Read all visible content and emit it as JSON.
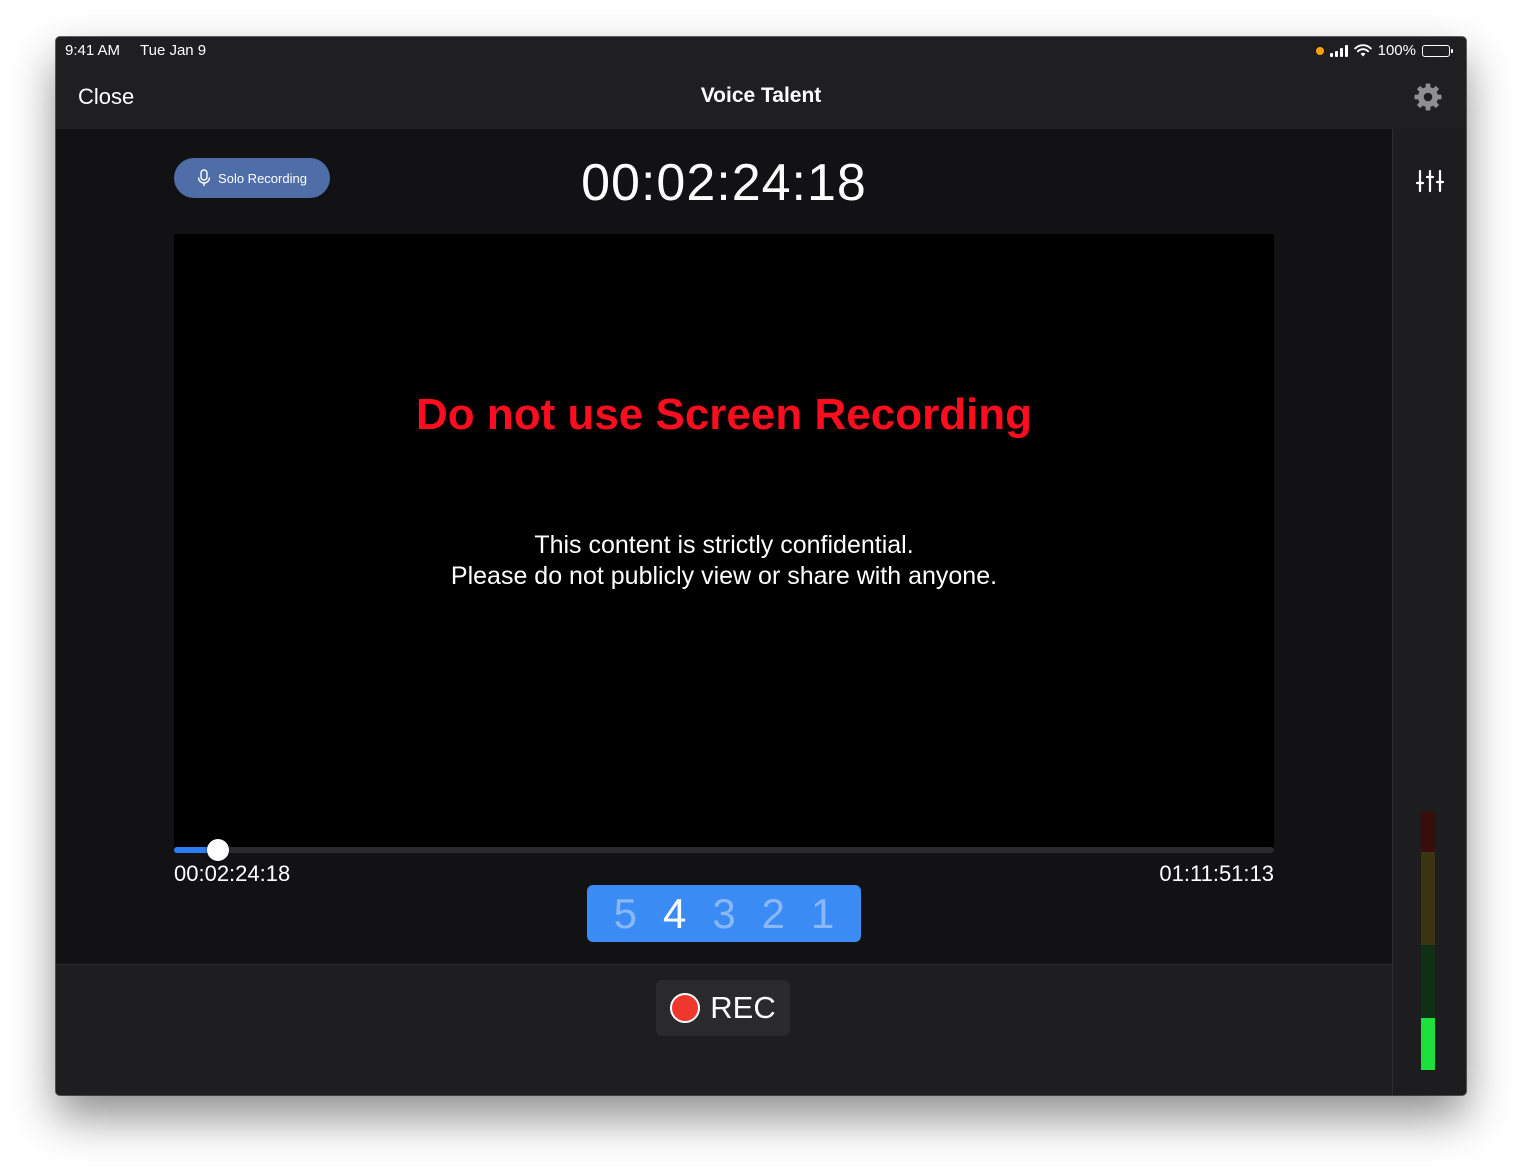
{
  "status_bar": {
    "time": "9:41 AM",
    "date": "Tue Jan 9",
    "battery": "100%"
  },
  "nav": {
    "close_label": "Close",
    "title": "Voice Talent",
    "settings_icon": "gear-icon"
  },
  "session": {
    "mode_label": "Solo Recording",
    "mode_icon": "microphone-icon",
    "timecode": "00:02:24:18"
  },
  "video": {
    "warning": "Do not use Screen Recording",
    "confidential_line1": "This content is strictly confidential.",
    "confidential_line2": "Please do not publicly view or share with anyone."
  },
  "playback": {
    "current_time": "00:02:24:18",
    "total_time": "01:11:51:13",
    "progress_fraction": 0.04
  },
  "countdown": {
    "digits": [
      "5",
      "4",
      "3",
      "2",
      "1"
    ],
    "active_index": 1
  },
  "record": {
    "label": "REC",
    "dot_color": "#f0372e"
  },
  "side_panel": {
    "mixer_icon": "sliders-icon",
    "level_meter_fraction": 0.2
  },
  "colors": {
    "accent": "#2c7cf6",
    "warning": "#ff0d1f",
    "pill": "#4f6ea8"
  }
}
